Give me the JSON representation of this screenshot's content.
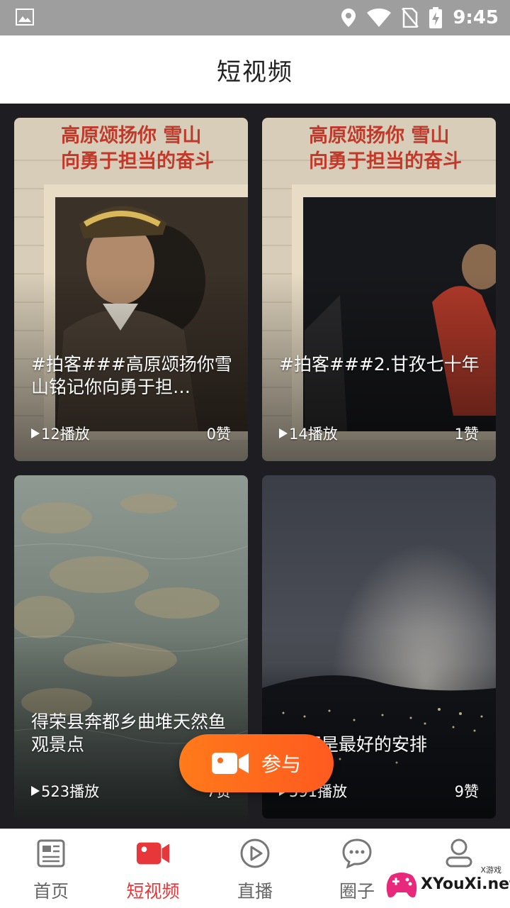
{
  "status_bar": {
    "time": "9:45",
    "icons": [
      "image-icon",
      "location-icon",
      "wifi-icon",
      "no-sim-icon",
      "battery-charging-icon"
    ]
  },
  "header": {
    "title": "短视频"
  },
  "videos": [
    {
      "caption": "#拍客###高原颂扬你雪山铭记你向勇于担…",
      "plays": "12播放",
      "likes": "0赞",
      "banner_text": "高原颂扬你 雪山\n向勇于担当的奋斗"
    },
    {
      "caption": "#拍客###2.甘孜七十年",
      "plays": "14播放",
      "likes": "1赞",
      "banner_text": "高原颂扬你 雪山\n向勇于担当的奋斗"
    },
    {
      "caption": "得荣县奔都乡曲堆天然鱼观景点",
      "plays": "523播放",
      "likes": "7赞"
    },
    {
      "caption": "都是最好的安排",
      "plays": "591播放",
      "likes": "9赞"
    }
  ],
  "participate_button": {
    "label": "参与"
  },
  "tabs": [
    {
      "label": "首页",
      "icon": "news-icon",
      "active": false
    },
    {
      "label": "短视频",
      "icon": "video-camera-icon",
      "active": true
    },
    {
      "label": "直播",
      "icon": "play-circle-icon",
      "active": false
    },
    {
      "label": "圈子",
      "icon": "chat-bubble-icon",
      "active": false
    },
    {
      "label": "",
      "icon": "user-icon",
      "active": false
    }
  ],
  "watermark": {
    "text": "XYouXi.net",
    "small": "X游戏"
  },
  "colors": {
    "accent": "#e8373a",
    "participate": "#ff6a1a",
    "status_bar": "#9e9e9e"
  }
}
